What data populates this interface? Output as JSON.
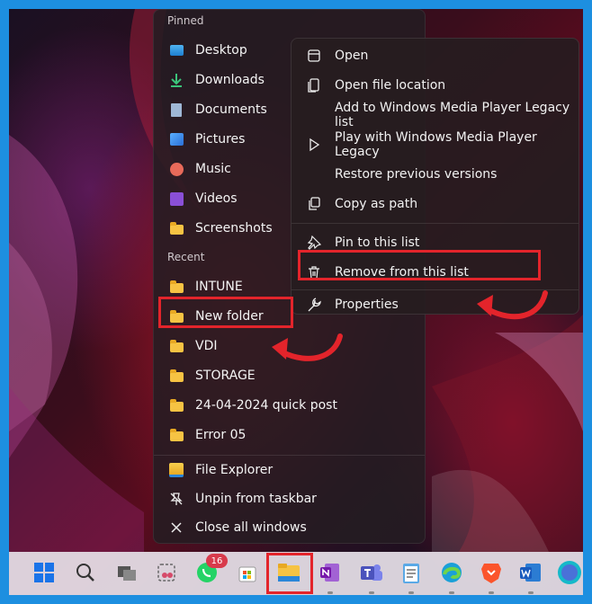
{
  "jumplist": {
    "pinned_header": "Pinned",
    "pinned": [
      {
        "label": "Desktop",
        "icon": "desktop-icon"
      },
      {
        "label": "Downloads",
        "icon": "download-icon"
      },
      {
        "label": "Documents",
        "icon": "documents-icon"
      },
      {
        "label": "Pictures",
        "icon": "pictures-icon"
      },
      {
        "label": "Music",
        "icon": "music-icon"
      },
      {
        "label": "Videos",
        "icon": "videos-icon"
      },
      {
        "label": "Screenshots",
        "icon": "folder-icon"
      }
    ],
    "recent_header": "Recent",
    "recent": [
      {
        "label": "INTUNE"
      },
      {
        "label": "New folder"
      },
      {
        "label": "VDI"
      },
      {
        "label": "STORAGE"
      },
      {
        "label": "24-04-2024 quick post"
      },
      {
        "label": "Error 05"
      }
    ],
    "actions": [
      {
        "label": "File Explorer",
        "icon": "file-explorer-icon"
      },
      {
        "label": "Unpin from taskbar",
        "icon": "unpin-icon"
      },
      {
        "label": "Close all windows",
        "icon": "close-icon"
      }
    ]
  },
  "context_menu": {
    "items": [
      {
        "label": "Open",
        "icon": "open-icon"
      },
      {
        "label": "Open file location",
        "icon": "file-location-icon"
      },
      {
        "label": "Add to Windows Media Player Legacy list",
        "icon": ""
      },
      {
        "label": "Play with Windows Media Player Legacy",
        "icon": "play-icon"
      },
      {
        "label": "Restore previous versions",
        "icon": ""
      },
      {
        "label": "Copy as path",
        "icon": "copy-icon"
      },
      {
        "label": "Pin to this list",
        "icon": "pin-icon"
      },
      {
        "label": "Remove from this list",
        "icon": "trash-icon"
      },
      {
        "label": "Properties",
        "icon": "wrench-icon"
      }
    ]
  },
  "taskbar": {
    "whatsapp_badge": "16",
    "icons": [
      "windows-start-icon",
      "search-icon",
      "task-view-icon",
      "snipping-tool-icon",
      "whatsapp-icon",
      "microsoft-store-icon",
      "file-explorer-icon",
      "onenote-icon",
      "teams-icon",
      "notepad-icon",
      "edge-icon",
      "brave-icon",
      "word-icon",
      "canva-icon"
    ]
  },
  "colors": {
    "highlight": "#e3242b",
    "folder": "#f6c343",
    "taskbar": "#e8e2ea"
  }
}
